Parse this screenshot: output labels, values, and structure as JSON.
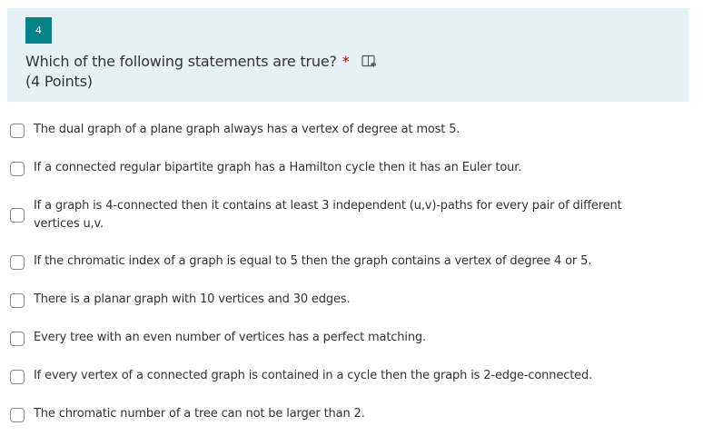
{
  "question": {
    "number": "4",
    "title": "Which of the following statements are true?",
    "required_marker": "*",
    "points": "(4 Points)",
    "icon": "immersive-reader-icon"
  },
  "colors": {
    "header_bg": "#e5f1f5",
    "badge_bg": "#038387",
    "required": "#a80000"
  },
  "options": [
    {
      "label": "The dual graph of a plane graph always has a vertex of degree at most 5.",
      "checked": false
    },
    {
      "label": "If a connected regular bipartite graph has a Hamilton cycle then it has an Euler tour.",
      "checked": false
    },
    {
      "label": "If a graph is 4-connected then it contains at least 3 independent (u,v)-paths for every pair of different vertices u,v.",
      "checked": false
    },
    {
      "label": "If the chromatic index of a graph is equal to 5 then the graph contains a vertex of degree 4 or 5.",
      "checked": false
    },
    {
      "label": "There is a planar graph with 10 vertices and 30 edges.",
      "checked": false
    },
    {
      "label": "Every tree with an even number of vertices has a perfect matching.",
      "checked": false
    },
    {
      "label": "If every vertex of a connected graph is contained in a cycle then the graph is 2-edge-connected.",
      "checked": false
    },
    {
      "label": "The chromatic number of a tree can not be larger than 2.",
      "checked": false
    }
  ]
}
